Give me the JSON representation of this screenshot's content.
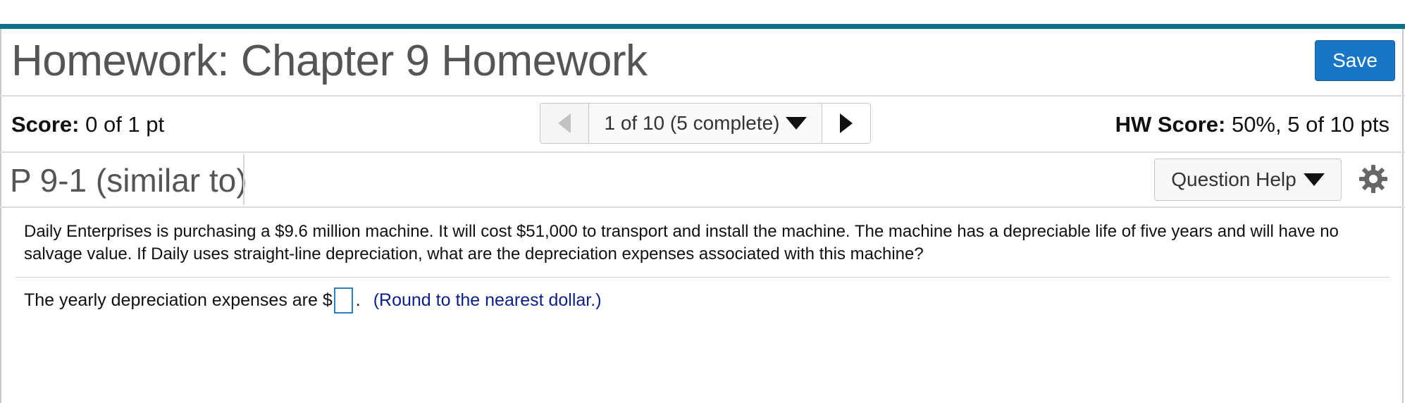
{
  "header": {
    "title": "Homework: Chapter 9 Homework",
    "save_label": "Save"
  },
  "score_bar": {
    "score_label": "Score:",
    "score_value": "0 of 1 pt",
    "nav_current": "1 of 10 (5 complete)",
    "hw_score_label": "HW Score:",
    "hw_score_value": "50%, 5 of 10 pts"
  },
  "question_bar": {
    "question_id": "P 9-1 (similar to)",
    "help_label": "Question Help",
    "icons": [
      "chevron-left-icon",
      "chevron-down-icon",
      "chevron-right-icon",
      "gear-icon"
    ]
  },
  "problem": {
    "text": "Daily Enterprises is purchasing a $9.6 million machine. It will cost $51,000 to transport and install the machine. The machine has a depreciable life of five years and will have no salvage value. If Daily uses straight-line depreciation, what are the depreciation expenses associated with this machine?",
    "answer_prefix": "The yearly depreciation expenses are $",
    "answer_value": "",
    "answer_suffix": ".",
    "hint": "(Round to the nearest dollar.)"
  },
  "colors": {
    "accent_bar": "#0e6f8a",
    "save_button": "#1976c6",
    "hint_text": "#0a1f8a",
    "input_border": "#2a7fc2"
  }
}
